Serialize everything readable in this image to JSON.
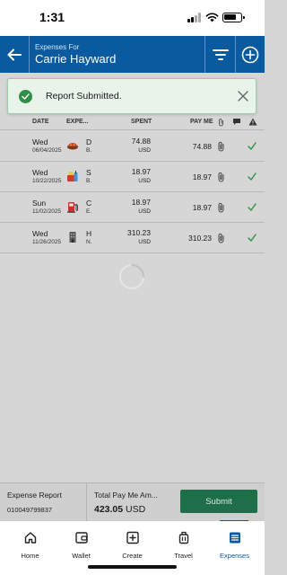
{
  "status_bar": {
    "time": "1:31"
  },
  "header": {
    "subtitle": "Expenses For",
    "name": "Carrie Hayward"
  },
  "toast": {
    "message": "Report Submitted."
  },
  "columns": {
    "date": "DATE",
    "expense": "EXPE...",
    "spent": "SPENT",
    "pay_me": "PAY ME"
  },
  "rows": [
    {
      "day": "Wed",
      "date": "06/04/2025",
      "icon": "meal-icon",
      "type_initial": "D",
      "vendor_initial": "B.",
      "amount": "74.88",
      "currency": "USD",
      "pay_me": "74.88"
    },
    {
      "day": "Wed",
      "date": "10/22/2025",
      "icon": "food-icon",
      "type_initial": "S",
      "vendor_initial": "B.",
      "amount": "18.97",
      "currency": "USD",
      "pay_me": "18.97"
    },
    {
      "day": "Sun",
      "date": "11/02/2025",
      "icon": "fuel-icon",
      "type_initial": "C",
      "vendor_initial": "E.",
      "amount": "18.97",
      "currency": "USD",
      "pay_me": "18.97"
    },
    {
      "day": "Wed",
      "date": "11/26/2025",
      "icon": "hotel-icon",
      "type_initial": "H",
      "vendor_initial": "N.",
      "amount": "310.23",
      "currency": "USD",
      "pay_me": "310.23"
    }
  ],
  "summary": {
    "report_label": "Expense Report",
    "report_id": "010049799837",
    "total_label": "Total Pay Me Am...",
    "total_amount": "423.05",
    "total_currency": "USD",
    "submit_label": "Submit"
  },
  "tabs": [
    {
      "label": "Home",
      "icon": "home-icon"
    },
    {
      "label": "Wallet",
      "icon": "wallet-icon"
    },
    {
      "label": "Create",
      "icon": "plus-square-icon"
    },
    {
      "label": "Travel",
      "icon": "luggage-icon"
    },
    {
      "label": "Expenses",
      "icon": "list-icon",
      "active": true
    }
  ],
  "colors": {
    "header": "#0a5aa0",
    "submit": "#1f6e4a",
    "success": "#2e8f45",
    "check": "#2f8f46"
  }
}
